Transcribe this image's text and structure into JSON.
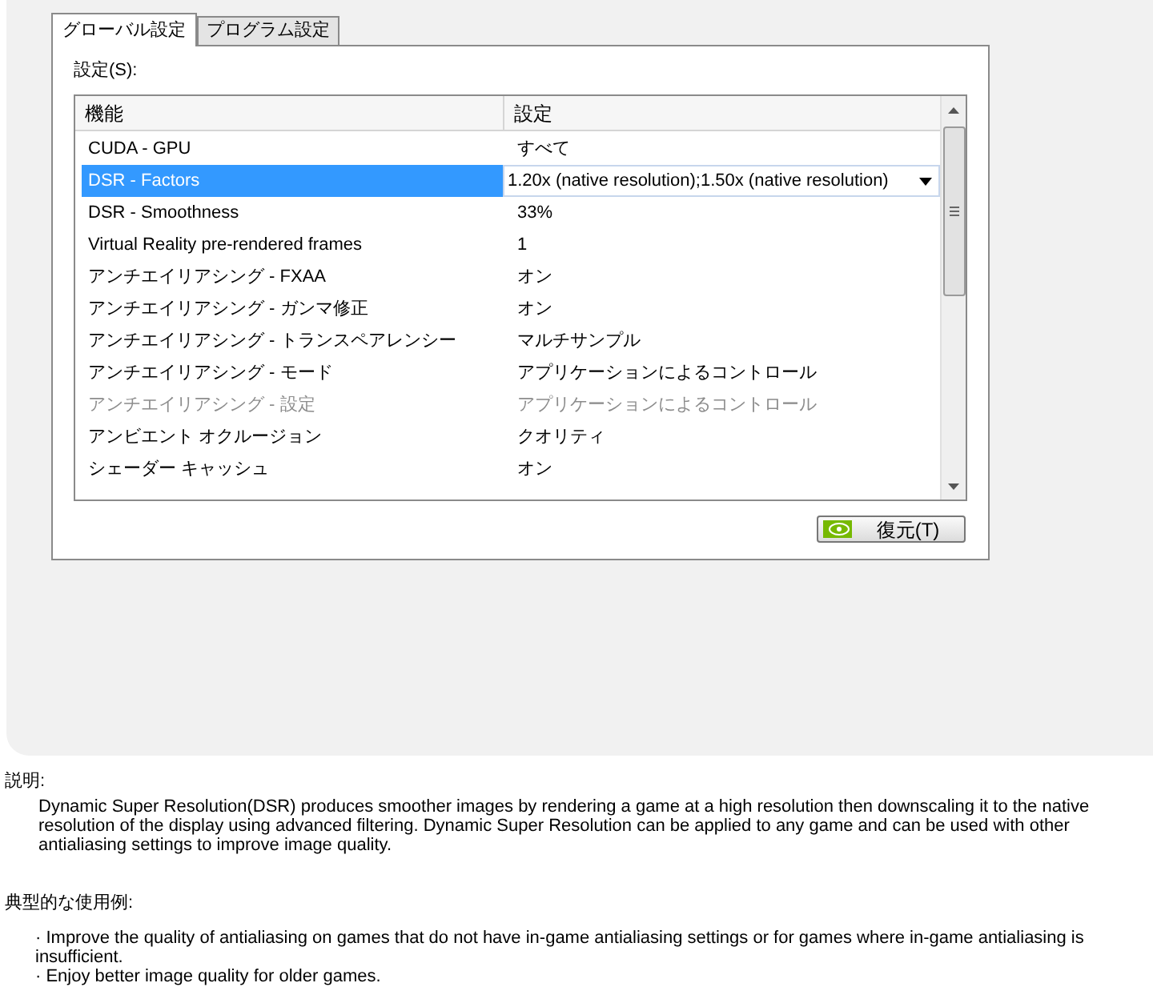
{
  "tabs": [
    {
      "label": "グローバル設定",
      "selected": true
    },
    {
      "label": "プログラム設定",
      "selected": false
    }
  ],
  "settings_label": "設定(S):",
  "table": {
    "columns": [
      "機能",
      "設定"
    ],
    "rows": [
      {
        "feature": "CUDA - GPU",
        "value": "すべて",
        "selected": false,
        "disabled": false
      },
      {
        "feature": "DSR - Factors",
        "value": "1.20x (native resolution);1.50x (native resolution)",
        "selected": true,
        "disabled": false
      },
      {
        "feature": "DSR - Smoothness",
        "value": "33%",
        "selected": false,
        "disabled": false
      },
      {
        "feature": "Virtual Reality pre-rendered frames",
        "value": "1",
        "selected": false,
        "disabled": false
      },
      {
        "feature": "アンチエイリアシング - FXAA",
        "value": "オン",
        "selected": false,
        "disabled": false
      },
      {
        "feature": "アンチエイリアシング - ガンマ修正",
        "value": "オン",
        "selected": false,
        "disabled": false
      },
      {
        "feature": "アンチエイリアシング - トランスペアレンシー",
        "value": "マルチサンプル",
        "selected": false,
        "disabled": false
      },
      {
        "feature": "アンチエイリアシング - モード",
        "value": "アプリケーションによるコントロール",
        "selected": false,
        "disabled": false
      },
      {
        "feature": "アンチエイリアシング - 設定",
        "value": "アプリケーションによるコントロール",
        "selected": false,
        "disabled": true
      },
      {
        "feature": "アンビエント オクルージョン",
        "value": "クオリティ",
        "selected": false,
        "disabled": false
      },
      {
        "feature": "シェーダー キャッシュ",
        "value": "オン",
        "selected": false,
        "disabled": false
      }
    ]
  },
  "restore_button": "復元(T)",
  "description": {
    "heading": "説明:",
    "text": "Dynamic Super Resolution(DSR) produces smoother images by rendering a game at a high resolution then downscaling it to the native resolution of the display using advanced filtering. Dynamic Super Resolution can be applied to any game and can be used with other antialiasing settings to improve image quality."
  },
  "usage": {
    "heading": "典型的な使用例:",
    "items": [
      "· Improve the quality of antialiasing on games that do not have in-game antialiasing settings or for games where in-game antialiasing is insufficient.",
      "· Enjoy better image quality for older games."
    ]
  }
}
